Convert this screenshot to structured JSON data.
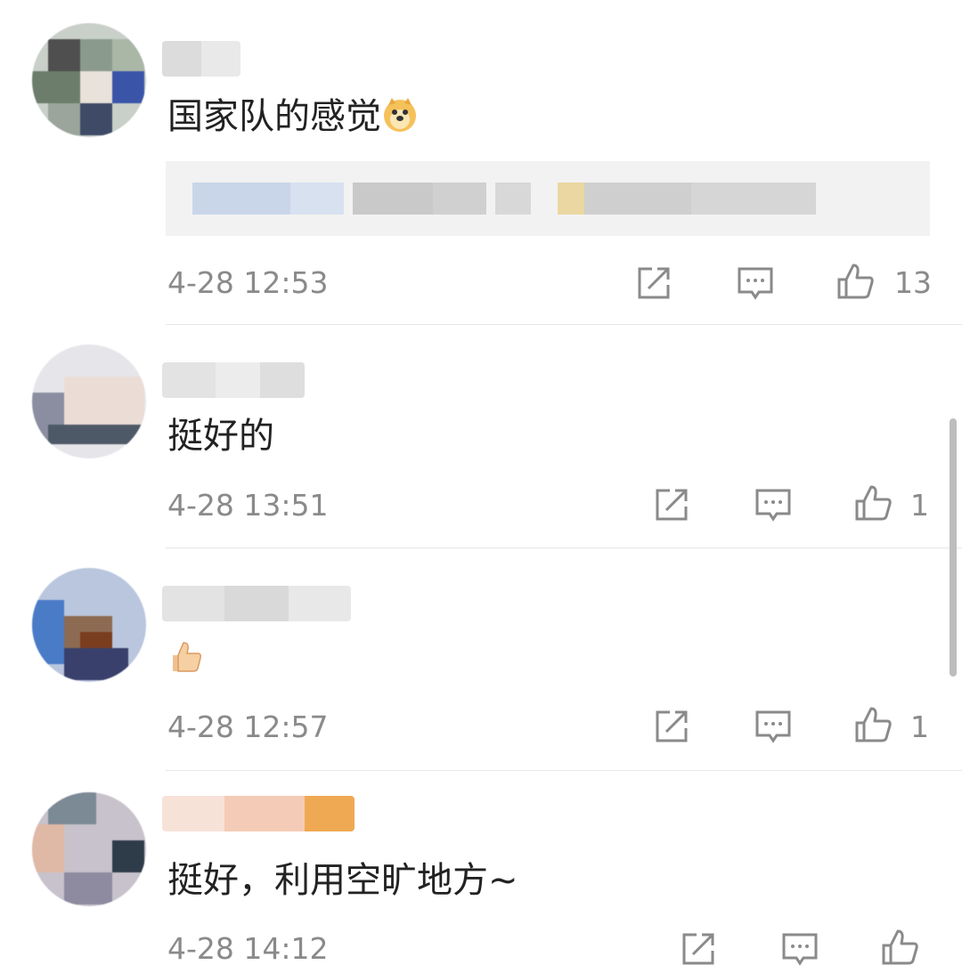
{
  "comments": [
    {
      "text": "国家队的感觉",
      "trailing_emoji": "doge-emoji",
      "has_quote": true,
      "time": "4-28 12:53",
      "likes": "13"
    },
    {
      "text": "挺好的",
      "time": "4-28 13:51",
      "likes": "1"
    },
    {
      "text": "",
      "leading_emoji": "thumbs-up-emoji",
      "time": "4-28 12:57",
      "likes": "1"
    },
    {
      "text": "挺好，利用空旷地方~",
      "time": "4-28 14:12",
      "likes": ""
    }
  ],
  "icons": {
    "share": "share-icon",
    "comment": "comment-icon",
    "like": "like-icon"
  },
  "colors": {
    "text": "#222222",
    "meta": "#8a8a8a",
    "divider": "#e6e6e6"
  }
}
